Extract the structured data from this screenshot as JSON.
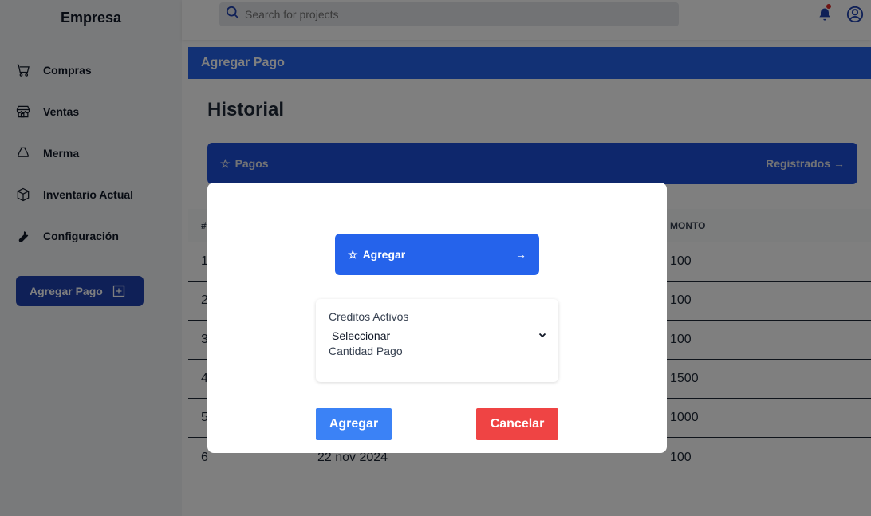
{
  "sidebar": {
    "brand": "Empresa",
    "items": [
      {
        "label": "Compras",
        "icon": "cart-icon"
      },
      {
        "label": "Ventas",
        "icon": "store-icon"
      },
      {
        "label": "Merma",
        "icon": "recycle-icon"
      },
      {
        "label": "Inventario Actual",
        "icon": "box-icon"
      },
      {
        "label": "Configuración",
        "icon": "wrench-icon"
      }
    ],
    "action_button": {
      "label": "Agregar Pago",
      "icon": "plus-square-icon"
    }
  },
  "topbar": {
    "search_placeholder": "Search for projects",
    "icons": [
      "search-icon",
      "bell-icon",
      "user-circle-icon"
    ]
  },
  "main": {
    "banner": "Agregar Pago",
    "title": "Historial",
    "pagos_bar": {
      "left_label": "Pagos",
      "right_label": "Registrados",
      "left_icon": "☆",
      "right_icon": "→"
    },
    "table": {
      "headers": [
        "#",
        "",
        "MONTO"
      ],
      "rows": [
        {
          "num": "1",
          "date": "",
          "monto": "100"
        },
        {
          "num": "2",
          "date": "",
          "monto": "100"
        },
        {
          "num": "3",
          "date": "",
          "monto": "100"
        },
        {
          "num": "4",
          "date": "",
          "monto": "1500"
        },
        {
          "num": "5",
          "date": "",
          "monto": "1000"
        },
        {
          "num": "6",
          "date": "22 nov 2024",
          "monto": "100"
        }
      ]
    }
  },
  "modal": {
    "top_button": {
      "label": "Agregar",
      "icon": "☆",
      "arrow": "→"
    },
    "form": {
      "credit_label": "Creditos Activos",
      "select_value": "Seleccionar",
      "amount_label": "Cantidad Pago"
    },
    "confirm_label": "Agregar",
    "cancel_label": "Cancelar"
  },
  "colors": {
    "primary": "#2563eb",
    "primary_dark": "#1d4ed8",
    "danger": "#ef4444",
    "overlay": "rgba(0,0,0,0.5)"
  }
}
